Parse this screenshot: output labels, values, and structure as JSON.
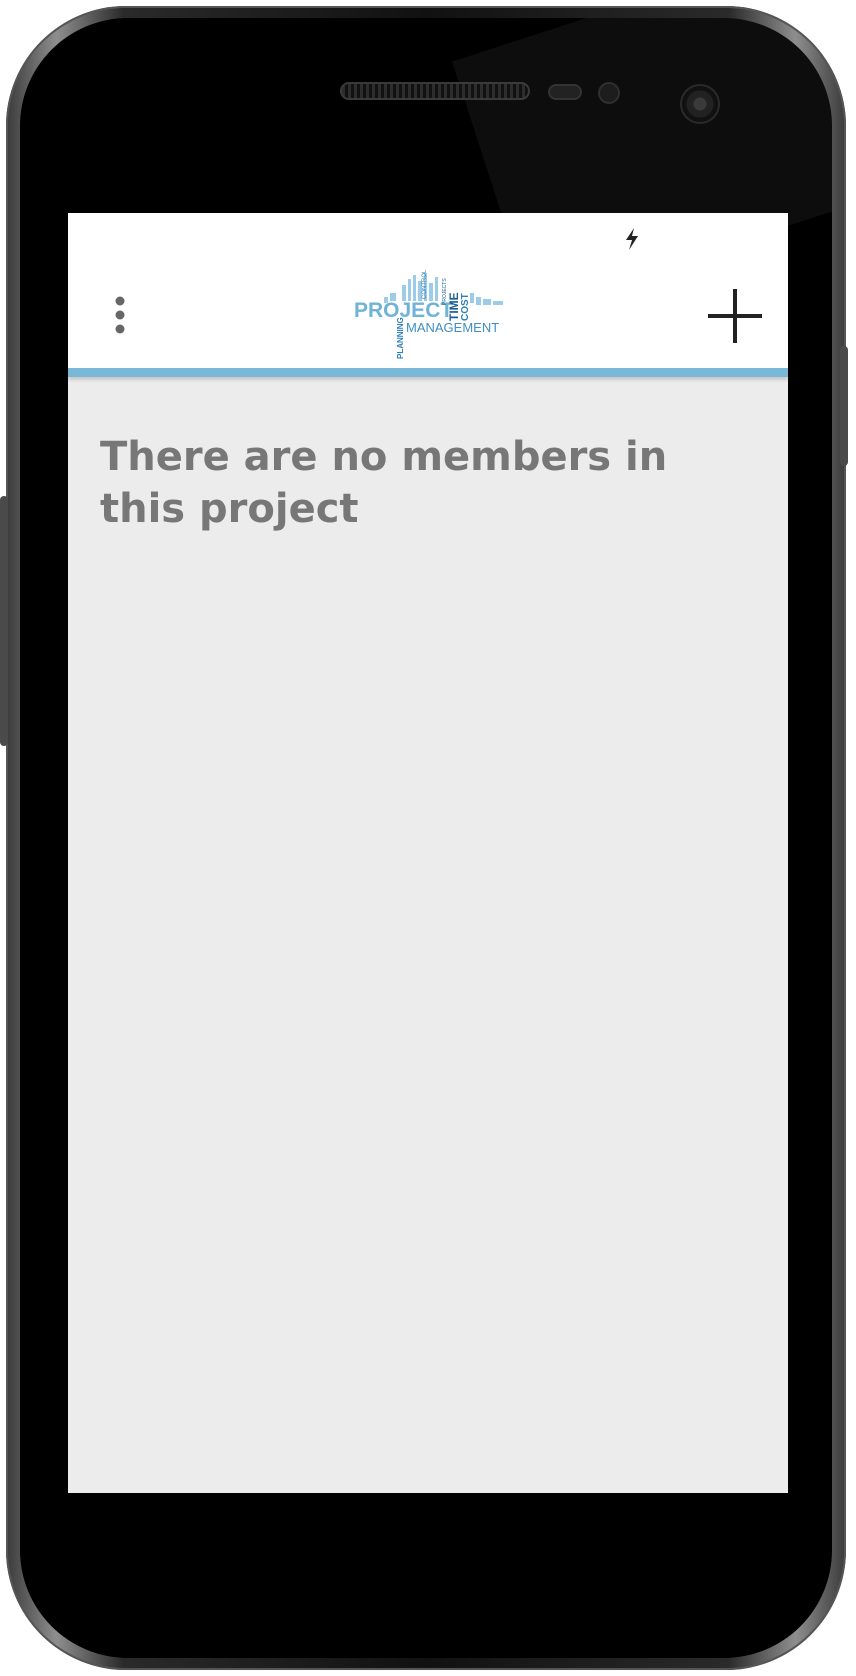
{
  "status_bar": {
    "icons": [
      "charging-bolt-icon"
    ]
  },
  "app_bar": {
    "menu_icon": "overflow-menu-icon",
    "logo": {
      "icon": "project-management-word-cloud-logo",
      "primary_text": "PROJECT",
      "secondary_text": "MANAGEMENT",
      "tags": [
        "TIME",
        "COST",
        "PLANNING",
        "CONTROL",
        "PROJECTS"
      ],
      "colors": [
        "#6fb3d9",
        "#2e7fb8",
        "#1d5f92"
      ]
    },
    "add_icon": "plus-icon",
    "accent_color": "#7ab8d8"
  },
  "main": {
    "empty_message": "There are no members in this project",
    "background": "#ececec",
    "text_color": "#777777"
  }
}
